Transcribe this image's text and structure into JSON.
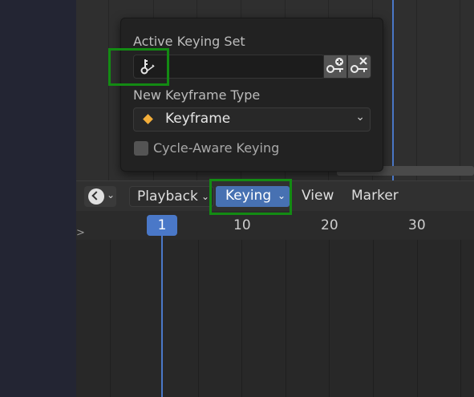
{
  "popup": {
    "active_keying_set_label": "Active Keying Set",
    "active_keying_set_value": "",
    "new_keyframe_type_label": "New Keyframe Type",
    "keyframe_type_value": "Keyframe",
    "cycle_aware_label": "Cycle-Aware Keying",
    "cycle_aware_checked": false
  },
  "header": {
    "editor_type_icon": "clock-icon",
    "menus": [
      "Playback",
      "Keying",
      "View",
      "Marker"
    ],
    "active_menu": "Keying"
  },
  "timeline": {
    "current_frame": "1",
    "ruler_labels": [
      "10",
      "20",
      "30"
    ]
  },
  "colors": {
    "accent": "#4a78c8",
    "keyframe_diamond": "#f3ae3a",
    "highlight": "#138b13",
    "active_menu_bg": "#4771b2"
  }
}
